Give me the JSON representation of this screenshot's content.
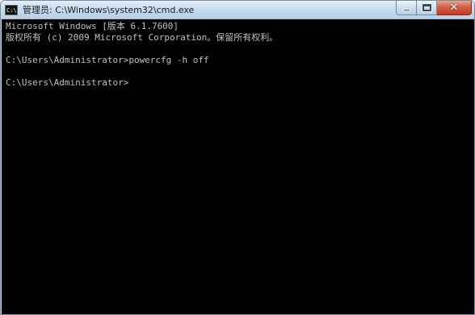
{
  "window": {
    "title": "管理员: C:\\Windows\\system32\\cmd.exe",
    "icon": "cmd-console-icon",
    "icon_prompt": "C:\\"
  },
  "controls": {
    "minimize_icon": "minimize-icon",
    "maximize_icon": "maximize-icon",
    "close_icon": "close-icon",
    "close_glyph": "✕"
  },
  "console": {
    "background": "#000000",
    "foreground": "#c0c0c0",
    "lines": [
      "Microsoft Windows [版本 6.1.7600]",
      "版权所有 (c) 2009 Microsoft Corporation。保留所有权利。",
      "",
      "C:\\Users\\Administrator>powercfg -h off",
      "",
      "C:\\Users\\Administrator>"
    ]
  }
}
